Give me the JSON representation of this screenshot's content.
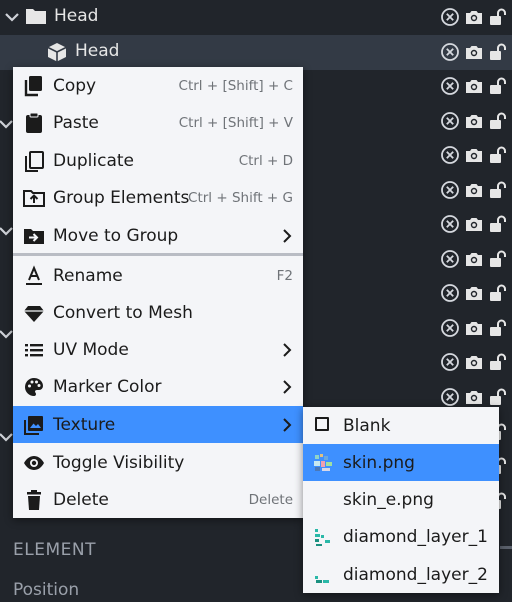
{
  "outliner": {
    "group_label": "Head",
    "cube_label": "Head"
  },
  "menu": {
    "items": [
      {
        "label": "Copy",
        "shortcut": "Ctrl + [Shift] + C"
      },
      {
        "label": "Paste",
        "shortcut": "Ctrl + [Shift] + V"
      },
      {
        "label": "Duplicate",
        "shortcut": "Ctrl + D"
      },
      {
        "label": "Group Elements",
        "shortcut": "Ctrl + Shift + G"
      },
      {
        "label": "Move to Group",
        "shortcut": ""
      },
      {
        "label": "Rename",
        "shortcut": "F2"
      },
      {
        "label": "Convert to Mesh",
        "shortcut": ""
      },
      {
        "label": "UV Mode",
        "shortcut": ""
      },
      {
        "label": "Marker Color",
        "shortcut": ""
      },
      {
        "label": "Texture",
        "shortcut": ""
      },
      {
        "label": "Toggle Visibility",
        "shortcut": ""
      },
      {
        "label": "Delete",
        "shortcut": "Delete"
      }
    ]
  },
  "texture_submenu": {
    "items": [
      {
        "label": "Blank"
      },
      {
        "label": "skin.png"
      },
      {
        "label": "skin_e.png"
      },
      {
        "label": "diamond_layer_1"
      },
      {
        "label": "diamond_layer_2"
      }
    ]
  },
  "element_panel": {
    "title": "ELEMENT",
    "position_label": "Position"
  },
  "colors": {
    "accent": "#3e90ff",
    "background": "#21252b",
    "selected_row": "#333a45",
    "menu_bg": "#f4f5f8"
  }
}
